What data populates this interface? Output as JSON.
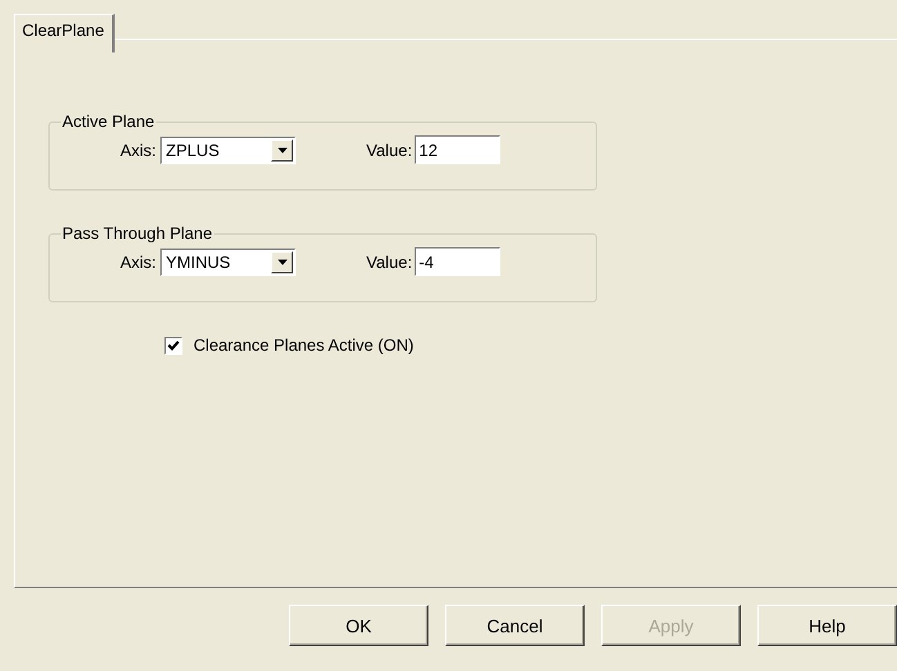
{
  "tabs": [
    {
      "label": "ClearPlane",
      "selected": true
    }
  ],
  "groups": [
    {
      "title": "Active Plane",
      "axis_label": "Axis:",
      "axis_value": "ZPLUS",
      "value_label": "Value:",
      "value": "12"
    },
    {
      "title": "Pass Through Plane",
      "axis_label": "Axis:",
      "axis_value": "YMINUS",
      "value_label": "Value:",
      "value": "-4"
    }
  ],
  "checkbox": {
    "label": "Clearance Planes Active (ON)",
    "checked": true
  },
  "buttons": [
    {
      "label": "OK",
      "disabled": false
    },
    {
      "label": "Cancel",
      "disabled": false
    },
    {
      "label": "Apply",
      "disabled": true
    },
    {
      "label": "Help",
      "disabled": false
    }
  ]
}
